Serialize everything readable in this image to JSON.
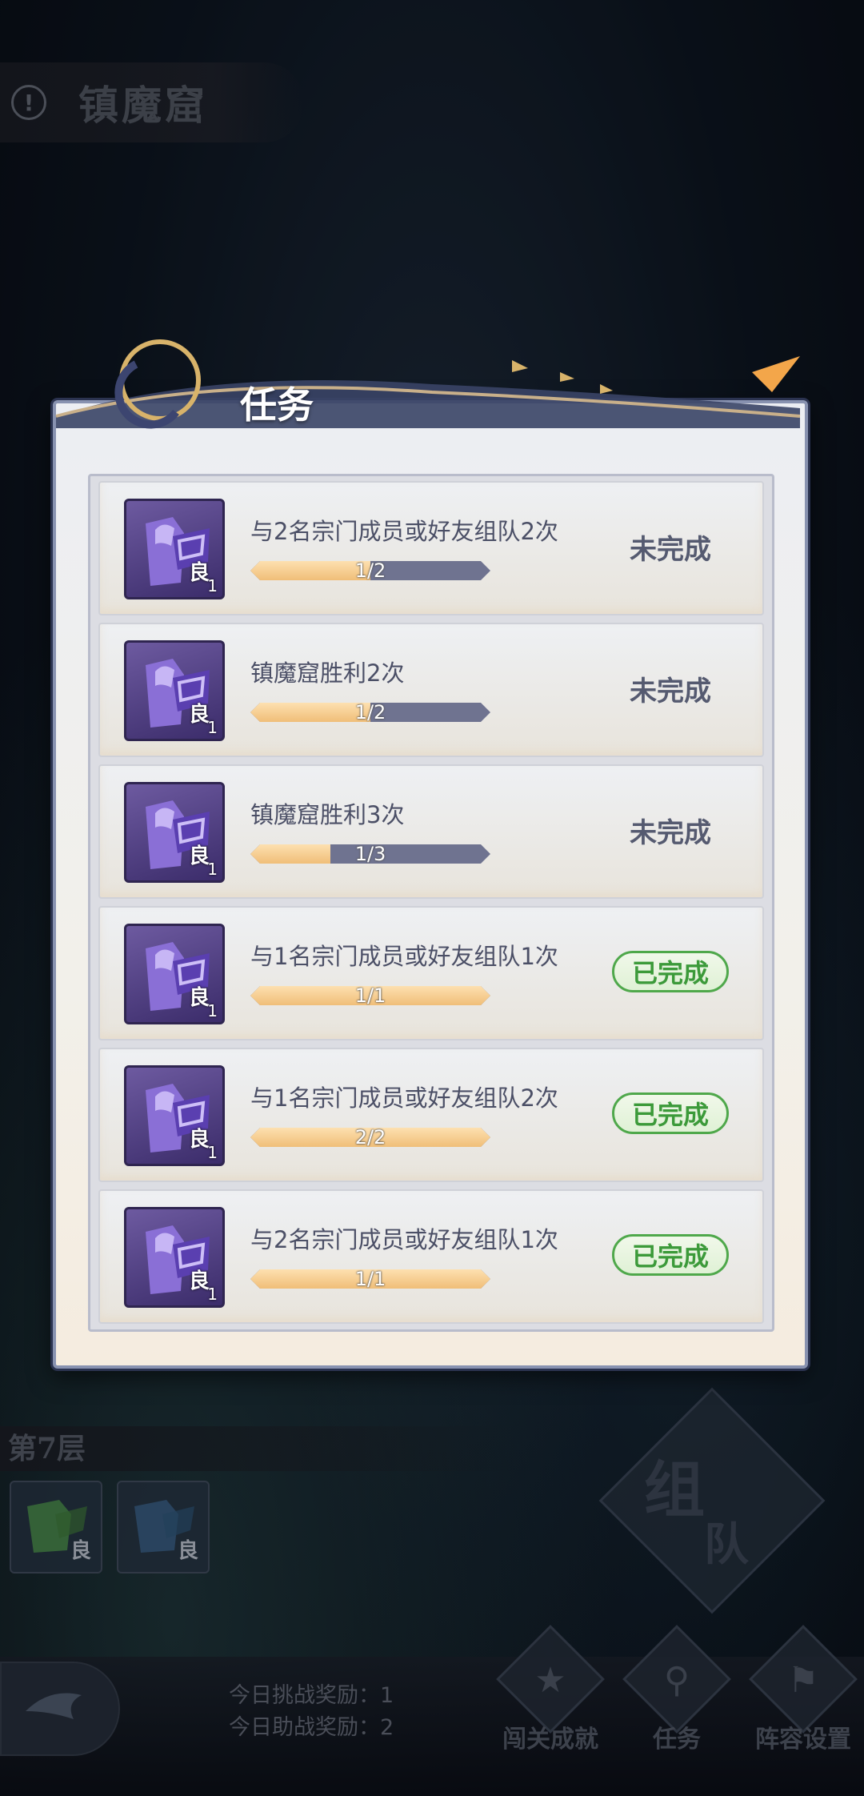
{
  "location": {
    "alert_symbol": "!",
    "title": "镇魔窟"
  },
  "modal": {
    "title": "任务",
    "tasks": [
      {
        "desc": "与2名宗门成员或好友组队2次",
        "progress_text": "1/2",
        "progress": 0.5,
        "status": "未完成",
        "completed": false,
        "reward_quality": "良",
        "reward_count": "1"
      },
      {
        "desc": "镇魔窟胜利2次",
        "progress_text": "1/2",
        "progress": 0.5,
        "status": "未完成",
        "completed": false,
        "reward_quality": "良",
        "reward_count": "1"
      },
      {
        "desc": "镇魔窟胜利3次",
        "progress_text": "1/3",
        "progress": 0.333,
        "status": "未完成",
        "completed": false,
        "reward_quality": "良",
        "reward_count": "1"
      },
      {
        "desc": "与1名宗门成员或好友组队1次",
        "progress_text": "1/1",
        "progress": 1.0,
        "status": "已完成",
        "completed": true,
        "reward_quality": "良",
        "reward_count": "1"
      },
      {
        "desc": "与1名宗门成员或好友组队2次",
        "progress_text": "2/2",
        "progress": 1.0,
        "status": "已完成",
        "completed": true,
        "reward_quality": "良",
        "reward_count": "1"
      },
      {
        "desc": "与2名宗门成员或好友组队1次",
        "progress_text": "1/1",
        "progress": 1.0,
        "status": "已完成",
        "completed": true,
        "reward_quality": "良",
        "reward_count": "1"
      }
    ]
  },
  "floor": {
    "label": "第7层",
    "rewards": [
      {
        "quality": "良",
        "color": "#3f7a3a"
      },
      {
        "quality": "良",
        "color": "#2f5070"
      }
    ]
  },
  "team_button": {
    "char1": "组",
    "char2": "队"
  },
  "bottom": {
    "challenge_reward": "今日挑战奖励：1",
    "assist_reward": "今日助战奖励：2",
    "nav": [
      {
        "label": "闯关成就",
        "glyph": "★",
        "icon": "star-icon"
      },
      {
        "label": "任务",
        "glyph": "⚲",
        "icon": "scroll-icon"
      },
      {
        "label": "阵容设置",
        "glyph": "⚑",
        "icon": "flag-icon"
      }
    ]
  },
  "colors": {
    "incomplete_status": "#555a70",
    "complete_status": "#3c9a3a",
    "progress_fill": "#f0be78",
    "progress_track": "#6f7390",
    "icon_purple": "#6d5aa0"
  }
}
